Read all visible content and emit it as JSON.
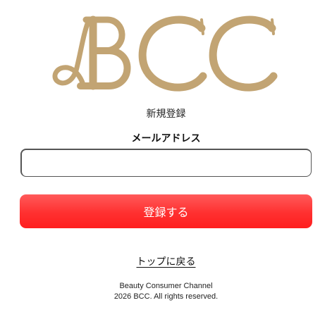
{
  "brand": {
    "logo_text": "BCC",
    "logo_color": "#c2a473"
  },
  "page": {
    "title": "新規登録"
  },
  "form": {
    "email_label": "メールアドレス",
    "email_value": "",
    "email_placeholder": "",
    "submit_label": "登録する",
    "submit_color": "#ff2d2d"
  },
  "nav": {
    "back_to_top_label": "トップに戻る"
  },
  "footer": {
    "site_name": "Beauty Consumer Channel",
    "copyright": "2026 BCC. All rights reserved."
  }
}
